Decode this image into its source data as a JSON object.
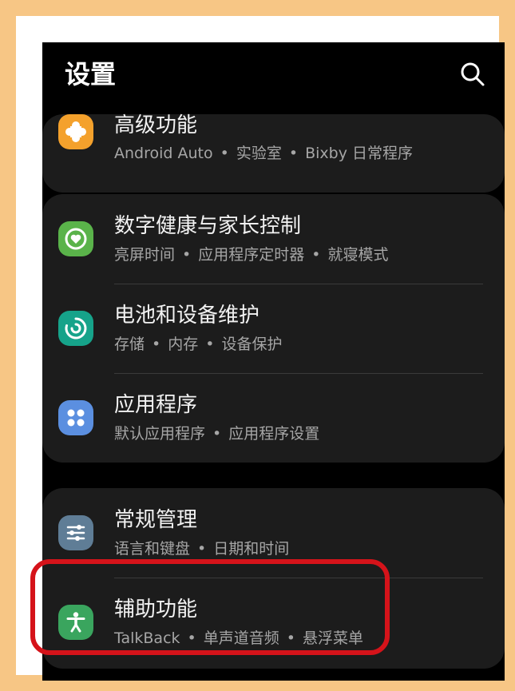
{
  "header": {
    "title": "设置",
    "search_icon": "search-icon"
  },
  "items": [
    {
      "id": "advanced",
      "title": "高级功能",
      "subtitle": [
        "Android Auto",
        "实验室",
        "Bixby 日常程序"
      ],
      "icon": "puzzle-icon",
      "icon_color": "#f4a12c"
    },
    {
      "id": "digital-wellbeing",
      "title": "数字健康与家长控制",
      "subtitle": [
        "亮屏时间",
        "应用程序定时器",
        "就寝模式"
      ],
      "icon": "wellbeing-icon",
      "icon_color": "#5ab34a"
    },
    {
      "id": "battery",
      "title": "电池和设备维护",
      "subtitle": [
        "存储",
        "内存",
        "设备保护"
      ],
      "icon": "device-care-icon",
      "icon_color": "#16a38a"
    },
    {
      "id": "apps",
      "title": "应用程序",
      "subtitle": [
        "默认应用程序",
        "应用程序设置"
      ],
      "icon": "apps-icon",
      "icon_color": "#5b8fe0"
    },
    {
      "id": "general-management",
      "title": "常规管理",
      "subtitle": [
        "语言和键盘",
        "日期和时间"
      ],
      "icon": "sliders-icon",
      "icon_color": "#5f7d96"
    },
    {
      "id": "accessibility",
      "title": "辅助功能",
      "subtitle": [
        "TalkBack",
        "单声道音频",
        "悬浮菜单"
      ],
      "icon": "accessibility-icon",
      "icon_color": "#3aa55e"
    }
  ],
  "separator": "•",
  "highlight_color": "#d5131a"
}
